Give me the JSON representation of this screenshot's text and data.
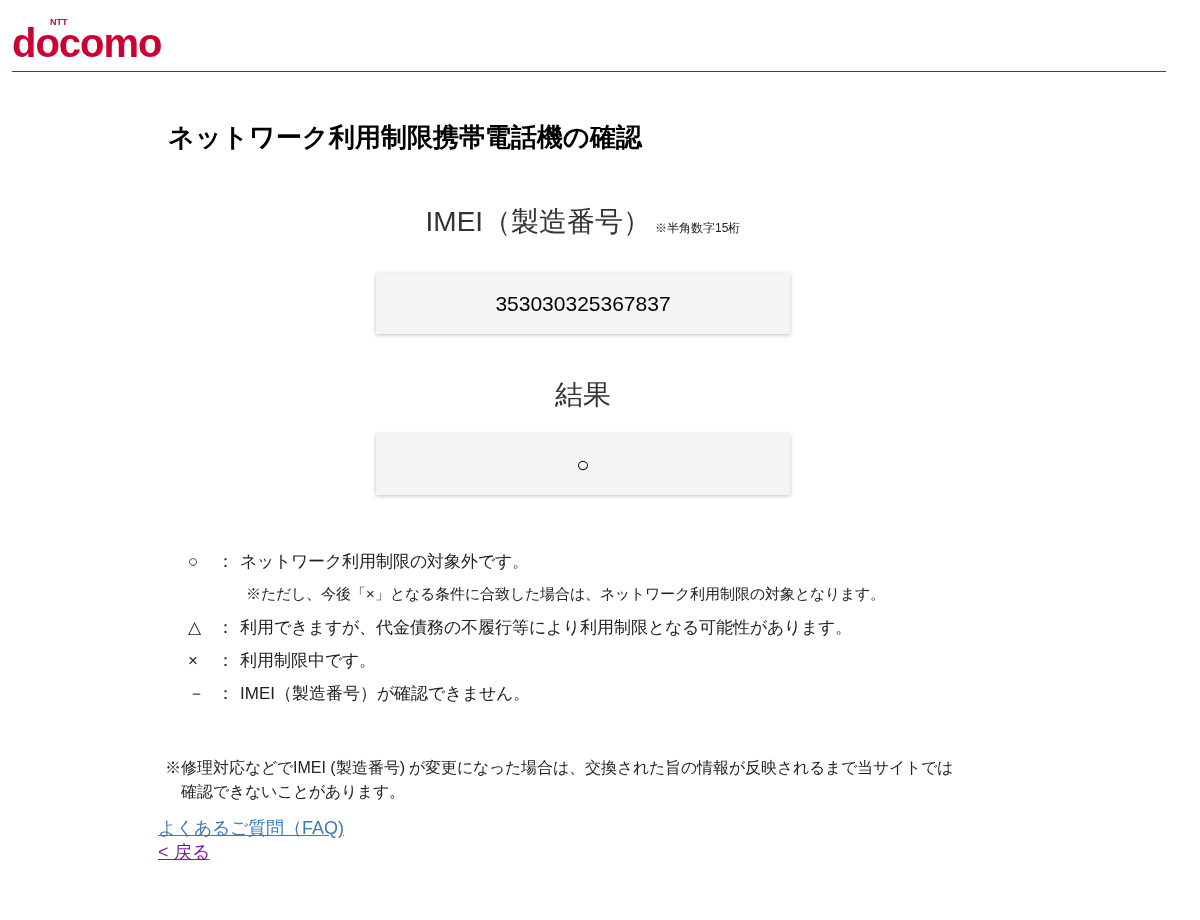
{
  "header": {
    "logo": {
      "top": "NTT",
      "main": "docomo"
    }
  },
  "title": "ネットワーク利用制限携帯電話機の確認",
  "imei": {
    "label": "IMEI（製造番号）",
    "hint": "※半角数字15桁",
    "value": "353030325367837"
  },
  "result": {
    "label": "結果",
    "value": "○"
  },
  "legend": [
    {
      "symbol": "○",
      "separator": "：",
      "text": "ネットワーク利用制限の対象外です。",
      "note": "※ただし、今後「×」となる条件に合致した場合は、ネットワーク利用制限の対象となります。"
    },
    {
      "symbol": "△",
      "separator": "：",
      "text": "利用できますが、代金債務の不履行等により利用制限となる可能性があります。"
    },
    {
      "symbol": "×",
      "separator": "：",
      "text": "利用制限中です。"
    },
    {
      "symbol": "－",
      "separator": "：",
      "text": "IMEI（製造番号）が確認できません。"
    }
  ],
  "note": "※修理対応などでIMEI (製造番号) が変更になった場合は、交換された旨の情報が反映されるまで当サイトでは確認できないことがあります。",
  "links": [
    {
      "label": "よくあるご質問（FAQ)",
      "visited": false
    },
    {
      "label": "< 戻る",
      "visited": true
    }
  ]
}
